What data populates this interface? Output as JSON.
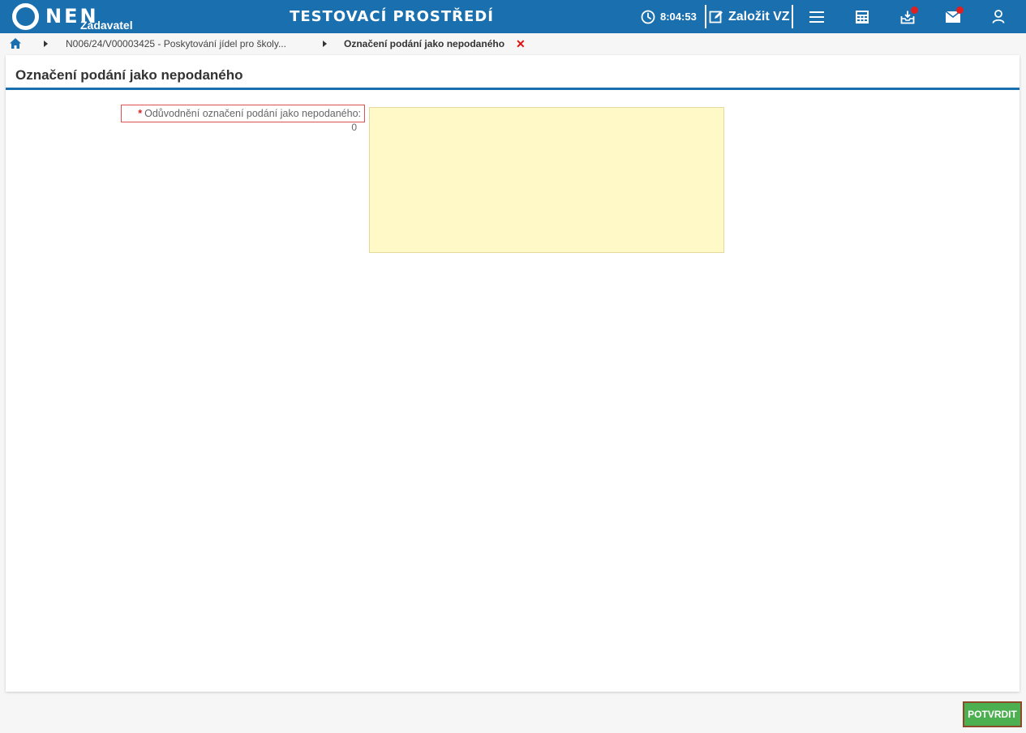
{
  "header": {
    "logo_text": "NEN",
    "logo_sub": "Zadavatel",
    "env_title": "TESTOVACÍ PROSTŘEDÍ",
    "clock_time": "8:04:53",
    "create_label": "Založit VZ",
    "icons": [
      "menu-icon",
      "calculator-icon",
      "inbox-icon",
      "mail-icon",
      "user-icon"
    ],
    "notification_color": "#e02020",
    "brand_color": "#1a6fae"
  },
  "breadcrumb": {
    "item1": "N006/24/V00003425 - Poskytování jídel pro školy...",
    "current": "Označení podání jako nepodaného",
    "close_glyph": "✕"
  },
  "panel": {
    "title": "Označení podání jako nepodaného",
    "field_required_mark": "*",
    "field_label": "Odůvodnění označení podání jako nepodaného:",
    "char_count": "0",
    "field_value": ""
  },
  "footer": {
    "confirm_label": "POTVRDIT",
    "confirm_color": "#4caf50"
  }
}
